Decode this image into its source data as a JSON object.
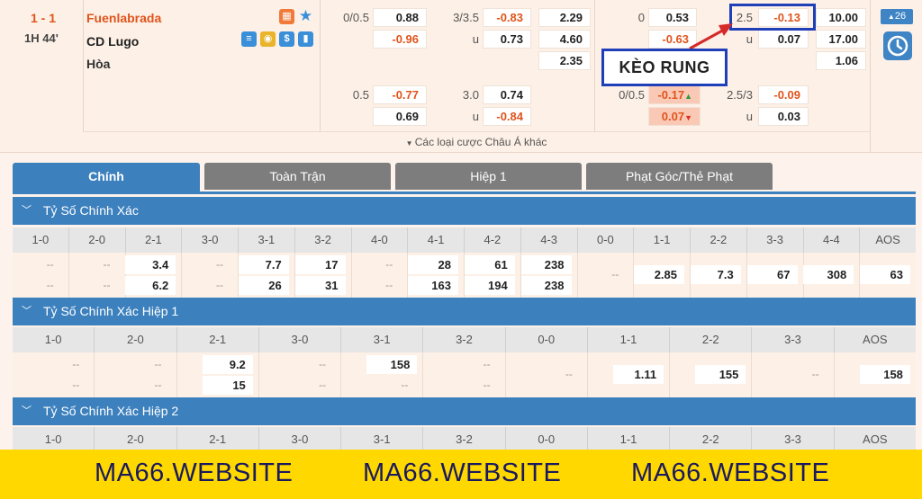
{
  "match": {
    "score": "1 - 1",
    "time": "1H 44'",
    "home": "Fuenlabrada",
    "away": "CD Lugo",
    "draw": "Hòa"
  },
  "odds": {
    "r1": {
      "l1": "0/0.5",
      "v1": "0.88",
      "l2": "3/3.5",
      "v2": "-0.83",
      "v3": "2.29",
      "l4": "0",
      "v4": "0.53",
      "l5": "2.5",
      "v5": "-0.13",
      "v6": "10.00"
    },
    "r2": {
      "v1": "-0.96",
      "l2": "u",
      "v2": "0.73",
      "v3": "4.60",
      "v4": "-0.63",
      "l5": "u",
      "v5": "0.07",
      "v6": "17.00"
    },
    "r3": {
      "v3": "2.35",
      "v6": "1.06"
    },
    "r4": {
      "l1": "0.5",
      "v1": "-0.77",
      "l2": "3.0",
      "v2": "0.74",
      "l4": "0/0.5",
      "v4": "-0.17",
      "l5": "2.5/3",
      "v5": "-0.09"
    },
    "r5": {
      "v1": "0.69",
      "l2": "u",
      "v2": "-0.84",
      "v4": "0.07",
      "l5": "u",
      "v5": "0.03"
    },
    "more": "Các loại cược Châu Á khác",
    "badge": "26",
    "callout": "KÈO RUNG"
  },
  "tabs": [
    "Chính",
    "Toàn Trận",
    "Hiệp 1",
    "Phạt Góc/Thẻ Phạt"
  ],
  "sections": {
    "s1": {
      "title": "Tỷ Số Chính Xác",
      "headers": [
        "1-0",
        "2-0",
        "2-1",
        "3-0",
        "3-1",
        "3-2",
        "4-0",
        "4-1",
        "4-2",
        "4-3",
        "0-0",
        "1-1",
        "2-2",
        "3-3",
        "4-4",
        "AOS"
      ],
      "top": [
        "--",
        "--",
        "3.4",
        "--",
        "7.7",
        "17",
        "--",
        "28",
        "61",
        "238",
        "",
        "",
        "",
        "",
        "",
        ""
      ],
      "bottom": [
        "--",
        "--",
        "6.2",
        "--",
        "26",
        "31",
        "--",
        "163",
        "194",
        "238",
        "",
        "",
        "",
        "",
        "",
        ""
      ],
      "mid": [
        "",
        "",
        "",
        "",
        "",
        "",
        "",
        "",
        "",
        "",
        "--",
        "2.85",
        "7.3",
        "67",
        "308",
        "63"
      ]
    },
    "s2": {
      "title": "Tỷ Số Chính Xác Hiệp 1",
      "headers": [
        "1-0",
        "2-0",
        "2-1",
        "3-0",
        "3-1",
        "3-2",
        "0-0",
        "1-1",
        "2-2",
        "3-3",
        "AOS"
      ],
      "top": [
        "--",
        "--",
        "9.2",
        "--",
        "158",
        "--",
        "",
        "",
        "",
        "",
        ""
      ],
      "bottom": [
        "--",
        "--",
        "15",
        "--",
        "--",
        "--",
        "",
        "",
        "",
        "",
        ""
      ],
      "mid": [
        "",
        "",
        "",
        "",
        "",
        "",
        "--",
        "1.11",
        "155",
        "--",
        "158"
      ]
    },
    "s3": {
      "title": "Tỷ Số Chính Xác Hiệp 2",
      "headers": [
        "1-0",
        "2-0",
        "2-1",
        "3-0",
        "3-1",
        "3-2",
        "0-0",
        "1-1",
        "2-2",
        "3-3",
        "AOS"
      ]
    }
  },
  "watermark": [
    "MA66.WEBSITE",
    "MA66.WEBSITE",
    "MA66.WEBSITE"
  ],
  "colors": {
    "accent": "#3c80bd",
    "orange": "#e0541c",
    "highlight": "#1f3fb8",
    "footer": "#ffd800"
  }
}
